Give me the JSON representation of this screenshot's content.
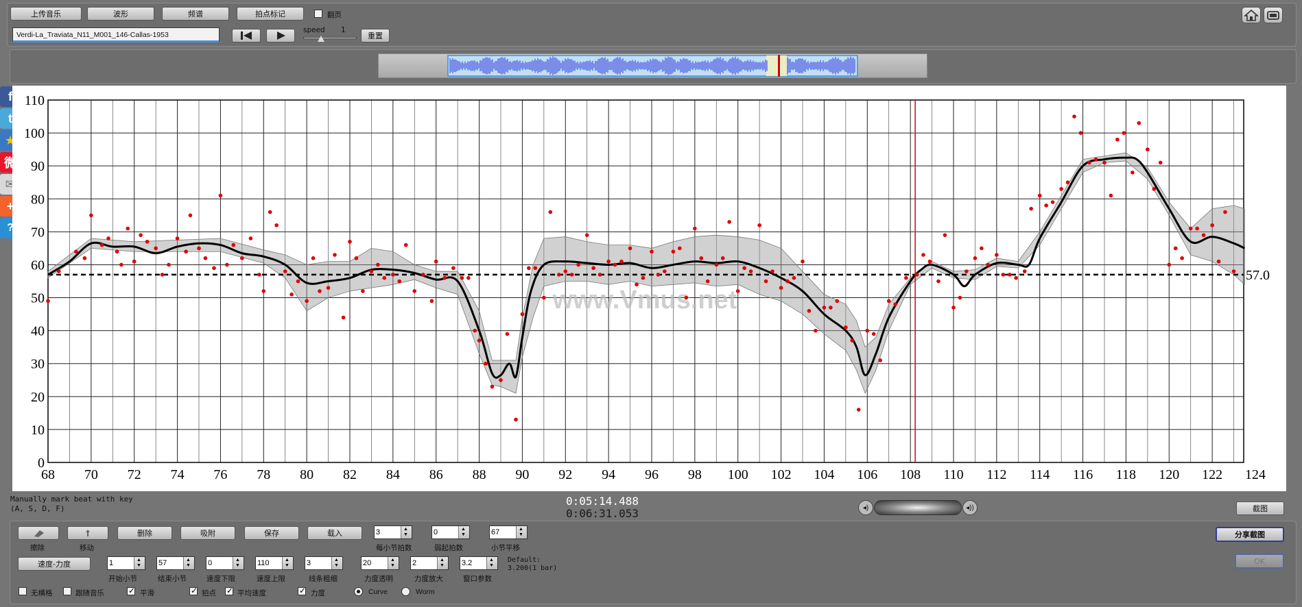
{
  "toolbar": {
    "upload_music": "上传音乐",
    "waveform": "波形",
    "spectrum": "频谱",
    "beat_mark": "拍点标记",
    "flip_page": "翻页",
    "track_name": "Verdi-La_Traviata_N11_M001_146-Callas-1953",
    "speed_label": "speed",
    "speed_value": "1",
    "reset": "重置"
  },
  "chart_data": {
    "type": "scatter",
    "xlim": [
      68,
      124
    ],
    "ylim": [
      0,
      110
    ],
    "x_ticks": [
      68,
      70,
      72,
      74,
      76,
      78,
      80,
      82,
      84,
      86,
      88,
      90,
      92,
      94,
      96,
      98,
      100,
      102,
      104,
      106,
      108,
      110,
      112,
      114,
      116,
      118,
      120,
      122,
      124
    ],
    "y_ticks": [
      0,
      10,
      20,
      30,
      40,
      50,
      60,
      70,
      80,
      90,
      100,
      110
    ],
    "average_line": 57.0,
    "average_label": "57.0",
    "playhead_x": 108,
    "watermark": "www.Vmus.net",
    "curve": [
      [
        68,
        57
      ],
      [
        69,
        61
      ],
      [
        70,
        66.5
      ],
      [
        71,
        65.5
      ],
      [
        72,
        65.5
      ],
      [
        73,
        63.5
      ],
      [
        74,
        65.5
      ],
      [
        75,
        66.5
      ],
      [
        76,
        66
      ],
      [
        77,
        63.5
      ],
      [
        78,
        62.5
      ],
      [
        79,
        60
      ],
      [
        80,
        54.5
      ],
      [
        81,
        55
      ],
      [
        82,
        56
      ],
      [
        83,
        58.5
      ],
      [
        84,
        58.5
      ],
      [
        85,
        57.5
      ],
      [
        86,
        55.5
      ],
      [
        87,
        55
      ],
      [
        88,
        40
      ],
      [
        88.6,
        27
      ],
      [
        89,
        26.5
      ],
      [
        89.4,
        30
      ],
      [
        89.7,
        26
      ],
      [
        90,
        38
      ],
      [
        90.4,
        52
      ],
      [
        91,
        60
      ],
      [
        92,
        61
      ],
      [
        93,
        60.5
      ],
      [
        94,
        60
      ],
      [
        95,
        60.5
      ],
      [
        96,
        59
      ],
      [
        97,
        60
      ],
      [
        98,
        61
      ],
      [
        99,
        60.5
      ],
      [
        100,
        61
      ],
      [
        101,
        59
      ],
      [
        102,
        56
      ],
      [
        103,
        52
      ],
      [
        104,
        45
      ],
      [
        105,
        40
      ],
      [
        105.5,
        35
      ],
      [
        105.9,
        26.5
      ],
      [
        106.4,
        33
      ],
      [
        107,
        44
      ],
      [
        108,
        55
      ],
      [
        108.5,
        58.5
      ],
      [
        109,
        60
      ],
      [
        110,
        57
      ],
      [
        110.5,
        53.5
      ],
      [
        111,
        57
      ],
      [
        112,
        60.5
      ],
      [
        113,
        60
      ],
      [
        113.5,
        60
      ],
      [
        114,
        68
      ],
      [
        115,
        79
      ],
      [
        116,
        90
      ],
      [
        117,
        92
      ],
      [
        118,
        92.5
      ],
      [
        118.5,
        92
      ],
      [
        119,
        88
      ],
      [
        120,
        77
      ],
      [
        121,
        67
      ],
      [
        122,
        68.5
      ],
      [
        123,
        66.5
      ],
      [
        123.5,
        65
      ]
    ],
    "band_upper": [
      [
        68,
        58
      ],
      [
        70,
        68
      ],
      [
        72,
        67
      ],
      [
        74,
        67.5
      ],
      [
        76,
        68
      ],
      [
        78,
        64.5
      ],
      [
        79,
        63
      ],
      [
        80,
        60
      ],
      [
        81,
        61
      ],
      [
        82,
        61
      ],
      [
        83,
        65
      ],
      [
        84,
        64
      ],
      [
        85,
        60
      ],
      [
        86,
        58
      ],
      [
        87,
        58
      ],
      [
        88,
        46
      ],
      [
        88.6,
        31
      ],
      [
        89,
        31
      ],
      [
        89.7,
        31
      ],
      [
        90,
        44
      ],
      [
        90.5,
        60
      ],
      [
        91,
        68
      ],
      [
        92,
        68.5
      ],
      [
        93,
        67
      ],
      [
        94,
        66
      ],
      [
        95,
        66
      ],
      [
        96,
        65
      ],
      [
        97,
        67
      ],
      [
        98,
        68.5
      ],
      [
        99,
        69
      ],
      [
        100,
        68.5
      ],
      [
        101,
        67.5
      ],
      [
        102,
        65
      ],
      [
        103,
        58
      ],
      [
        104,
        51
      ],
      [
        105,
        48
      ],
      [
        105.5,
        43
      ],
      [
        105.9,
        35
      ],
      [
        106.4,
        38
      ],
      [
        107,
        48
      ],
      [
        108,
        56
      ],
      [
        109,
        61
      ],
      [
        110,
        58
      ],
      [
        111,
        58.5
      ],
      [
        112,
        62
      ],
      [
        113,
        61
      ],
      [
        114,
        70
      ],
      [
        115,
        81
      ],
      [
        116,
        92
      ],
      [
        117,
        93
      ],
      [
        118,
        94
      ],
      [
        119,
        89.5
      ],
      [
        120,
        79
      ],
      [
        121,
        71
      ],
      [
        122,
        77
      ],
      [
        123,
        78
      ],
      [
        123.5,
        77
      ]
    ],
    "band_lower": [
      [
        68,
        56
      ],
      [
        70,
        65
      ],
      [
        72,
        64
      ],
      [
        74,
        64
      ],
      [
        76,
        64
      ],
      [
        78,
        60.5
      ],
      [
        79,
        56
      ],
      [
        80,
        46
      ],
      [
        81,
        50
      ],
      [
        82,
        52
      ],
      [
        83,
        53
      ],
      [
        84,
        54
      ],
      [
        85,
        55.5
      ],
      [
        86,
        53
      ],
      [
        87,
        51
      ],
      [
        88,
        33
      ],
      [
        88.6,
        23.5
      ],
      [
        89,
        23
      ],
      [
        89.7,
        21
      ],
      [
        90,
        32
      ],
      [
        90.5,
        44
      ],
      [
        91,
        53.5
      ],
      [
        92,
        55
      ],
      [
        93,
        55
      ],
      [
        94,
        54
      ],
      [
        95,
        55
      ],
      [
        96,
        53.5
      ],
      [
        97,
        54
      ],
      [
        98,
        54.5
      ],
      [
        99,
        53.5
      ],
      [
        100,
        54
      ],
      [
        101,
        51
      ],
      [
        102,
        49
      ],
      [
        103,
        45
      ],
      [
        104,
        39
      ],
      [
        105,
        34
      ],
      [
        105.5,
        28
      ],
      [
        105.9,
        21
      ],
      [
        106.4,
        28
      ],
      [
        107,
        40
      ],
      [
        108,
        54
      ],
      [
        109,
        59
      ],
      [
        110,
        56
      ],
      [
        111,
        55.5
      ],
      [
        112,
        59.5
      ],
      [
        113,
        59
      ],
      [
        114,
        66
      ],
      [
        115,
        77
      ],
      [
        116,
        88
      ],
      [
        117,
        91
      ],
      [
        118,
        91.5
      ],
      [
        119,
        86
      ],
      [
        120,
        75
      ],
      [
        121,
        63
      ],
      [
        122,
        61
      ],
      [
        123,
        57
      ],
      [
        123.5,
        54
      ]
    ],
    "points": [
      [
        68,
        49
      ],
      [
        68.5,
        58
      ],
      [
        69.3,
        64
      ],
      [
        69.7,
        62
      ],
      [
        70,
        75
      ],
      [
        70.5,
        66
      ],
      [
        70.8,
        68
      ],
      [
        71.2,
        64
      ],
      [
        71.4,
        60
      ],
      [
        71.7,
        71
      ],
      [
        72,
        61
      ],
      [
        72.3,
        69
      ],
      [
        72.6,
        67
      ],
      [
        73,
        65
      ],
      [
        73.3,
        57
      ],
      [
        73.6,
        60
      ],
      [
        74,
        68
      ],
      [
        74.4,
        64
      ],
      [
        74.6,
        75
      ],
      [
        75,
        65
      ],
      [
        75.3,
        62
      ],
      [
        75.7,
        59
      ],
      [
        76,
        81
      ],
      [
        76.3,
        60
      ],
      [
        76.6,
        66
      ],
      [
        77,
        62
      ],
      [
        77.4,
        68
      ],
      [
        77.8,
        57
      ],
      [
        78,
        52
      ],
      [
        78.3,
        76
      ],
      [
        78.6,
        72
      ],
      [
        79,
        58
      ],
      [
        79.3,
        51
      ],
      [
        79.6,
        55
      ],
      [
        80,
        49
      ],
      [
        80.3,
        62
      ],
      [
        80.6,
        52
      ],
      [
        81,
        53
      ],
      [
        81.3,
        63
      ],
      [
        81.7,
        44
      ],
      [
        82,
        67
      ],
      [
        82.3,
        62
      ],
      [
        82.6,
        52
      ],
      [
        83,
        58
      ],
      [
        83.3,
        60
      ],
      [
        83.6,
        56
      ],
      [
        84,
        57
      ],
      [
        84.3,
        55
      ],
      [
        84.6,
        66
      ],
      [
        85,
        52
      ],
      [
        85.4,
        57
      ],
      [
        85.8,
        49
      ],
      [
        86,
        61
      ],
      [
        86.4,
        56
      ],
      [
        86.8,
        59
      ],
      [
        87.2,
        56
      ],
      [
        87.5,
        56
      ],
      [
        87.8,
        40
      ],
      [
        88,
        37
      ],
      [
        88.3,
        30
      ],
      [
        88.6,
        23
      ],
      [
        89,
        25
      ],
      [
        89.3,
        39
      ],
      [
        89.7,
        13
      ],
      [
        90,
        45
      ],
      [
        90.3,
        59
      ],
      [
        90.6,
        59
      ],
      [
        91,
        50
      ],
      [
        91.3,
        76
      ],
      [
        91.7,
        57
      ],
      [
        92,
        58
      ],
      [
        92.3,
        57
      ],
      [
        92.6,
        60
      ],
      [
        93,
        69
      ],
      [
        93.3,
        59
      ],
      [
        93.6,
        57
      ],
      [
        94,
        61
      ],
      [
        94.3,
        60
      ],
      [
        94.6,
        61
      ],
      [
        95,
        65
      ],
      [
        95.3,
        54
      ],
      [
        95.6,
        56
      ],
      [
        96,
        64
      ],
      [
        96.3,
        57
      ],
      [
        96.6,
        58
      ],
      [
        97,
        64
      ],
      [
        97.3,
        65
      ],
      [
        97.6,
        50
      ],
      [
        98,
        71
      ],
      [
        98.3,
        62
      ],
      [
        98.6,
        55
      ],
      [
        99,
        60
      ],
      [
        99.3,
        62
      ],
      [
        99.6,
        73
      ],
      [
        100,
        52
      ],
      [
        100.3,
        59
      ],
      [
        100.6,
        58
      ],
      [
        101,
        72
      ],
      [
        101.3,
        55
      ],
      [
        101.6,
        58
      ],
      [
        102,
        53
      ],
      [
        102.3,
        55
      ],
      [
        102.6,
        56
      ],
      [
        103,
        61
      ],
      [
        103.3,
        46
      ],
      [
        103.6,
        40
      ],
      [
        104,
        47
      ],
      [
        104.3,
        47
      ],
      [
        104.6,
        49
      ],
      [
        105,
        41
      ],
      [
        105.3,
        37
      ],
      [
        105.6,
        16
      ],
      [
        106,
        40
      ],
      [
        106.3,
        39
      ],
      [
        106.6,
        31
      ],
      [
        107,
        49
      ],
      [
        107.3,
        48
      ],
      [
        107.8,
        56
      ],
      [
        108.3,
        57
      ],
      [
        108.6,
        63
      ],
      [
        108.9,
        61
      ],
      [
        109.3,
        55
      ],
      [
        109.6,
        69
      ],
      [
        110,
        47
      ],
      [
        110.3,
        50
      ],
      [
        110.6,
        58
      ],
      [
        111,
        62
      ],
      [
        111.3,
        65
      ],
      [
        111.6,
        60
      ],
      [
        112,
        63
      ],
      [
        112.3,
        57
      ],
      [
        112.6,
        57
      ],
      [
        112.9,
        56
      ],
      [
        113.3,
        58
      ],
      [
        113.6,
        77
      ],
      [
        114,
        81
      ],
      [
        114.3,
        78
      ],
      [
        114.6,
        79
      ],
      [
        115,
        83
      ],
      [
        115.3,
        85
      ],
      [
        115.6,
        105
      ],
      [
        115.9,
        100
      ],
      [
        116.3,
        91
      ],
      [
        116.6,
        92
      ],
      [
        117,
        91
      ],
      [
        117.3,
        81
      ],
      [
        117.6,
        98
      ],
      [
        117.9,
        100
      ],
      [
        118.3,
        88
      ],
      [
        118.6,
        103
      ],
      [
        119,
        95
      ],
      [
        119.3,
        83
      ],
      [
        119.6,
        91
      ],
      [
        120,
        60
      ],
      [
        120.3,
        65
      ],
      [
        120.6,
        62
      ],
      [
        121,
        71
      ],
      [
        121.3,
        71
      ],
      [
        121.6,
        69
      ],
      [
        122,
        72
      ],
      [
        122.3,
        61
      ],
      [
        122.6,
        76
      ],
      [
        123,
        58
      ]
    ]
  },
  "key_hint_line1": "Manually mark beat with key",
  "key_hint_line2": "(A, S, D, F)",
  "time_current": "0:05:14.488",
  "time_total": "0:06:31.053",
  "screenshot_btn": "截图",
  "share_screenshot_btn": "分享截图",
  "ok_btn": "OK",
  "bottom": {
    "erase": "擦除",
    "move": "移动",
    "delete": "删除",
    "snap": "吸附",
    "save": "保存",
    "load": "载入",
    "beats_per_bar_value": "3",
    "beats_per_bar_label": "每小节拍数",
    "pickup_beats_value": "0",
    "pickup_beats_label": "弱起拍数",
    "bar_shift_value": "67",
    "bar_shift_label": "小节平移",
    "tempo_dynamics": "速度-力度",
    "start_bar_value": "1",
    "start_bar_label": "开始小节",
    "end_bar_value": "57",
    "end_bar_label": "结束小节",
    "tempo_lower_value": "0",
    "tempo_lower_label": "速度下限",
    "tempo_upper_value": "110",
    "tempo_upper_label": "速度上限",
    "line_width_value": "3",
    "line_width_label": "线条粗细",
    "dyn_transparency_value": "20",
    "dyn_transparency_label": "力度透明",
    "dyn_scale_value": "2",
    "dyn_scale_label": "力度放大",
    "window_param_value": "3.2",
    "window_param_label": "窗口参数",
    "default_label": "Default:",
    "default_value": "3.200(1 bar)",
    "no_grid": "无横格",
    "follow_music": "跟随音乐",
    "smooth": "平滑",
    "beat_points": "拍点",
    "avg_tempo": "平均速度",
    "dynamics": "力度",
    "curve_opt": "Curve",
    "worm_opt": "Worm"
  }
}
